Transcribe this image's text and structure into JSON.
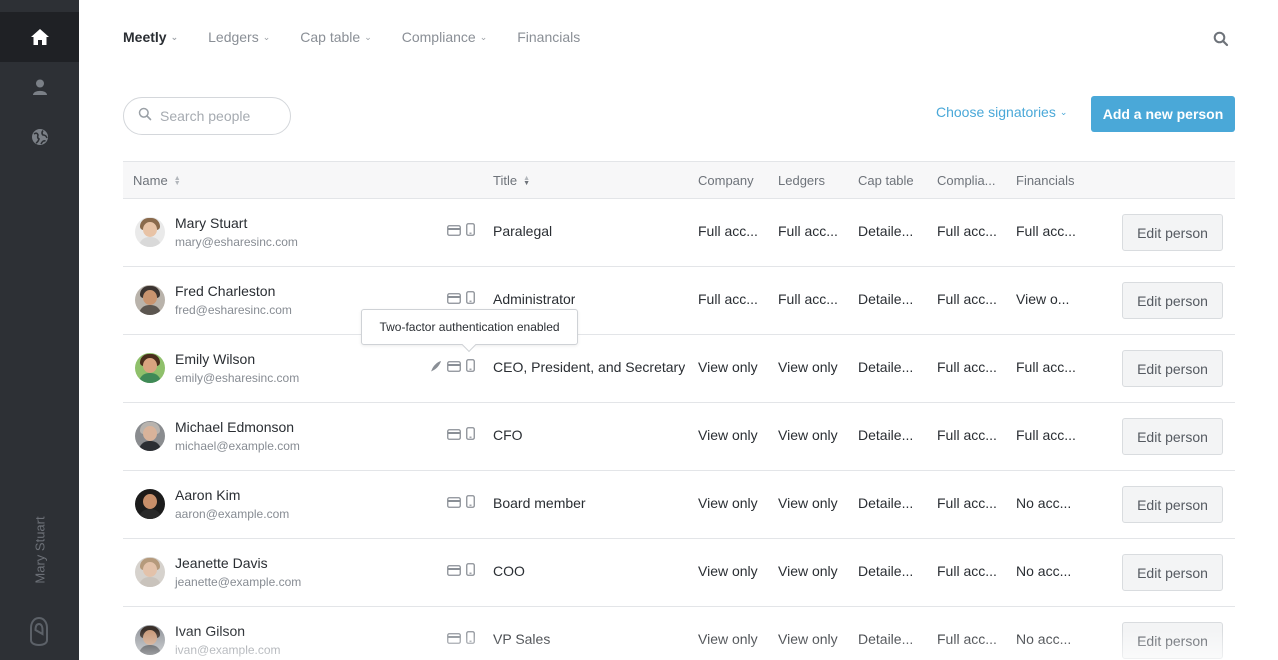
{
  "sidebar": {
    "items": [
      {
        "icon": "home-icon",
        "active": true
      },
      {
        "icon": "user-icon",
        "active": false
      },
      {
        "icon": "globe-icon",
        "active": false
      }
    ],
    "current_user": "Mary Stuart",
    "logo_icon": "eshares-logo-icon"
  },
  "topnav": {
    "items": [
      {
        "label": "Meetly",
        "dropdown": true,
        "active": true
      },
      {
        "label": "Ledgers",
        "dropdown": true,
        "active": false
      },
      {
        "label": "Cap table",
        "dropdown": true,
        "active": false
      },
      {
        "label": "Compliance",
        "dropdown": true,
        "active": false
      },
      {
        "label": "Financials",
        "dropdown": false,
        "active": false
      }
    ],
    "search_icon": "search-icon"
  },
  "toolbar": {
    "search_placeholder": "Search people",
    "choose_signatories": "Choose signatories",
    "add_person": "Add a new person"
  },
  "colors": {
    "accent": "#4aa8d8",
    "sidebar_bg": "#2d3035",
    "sidebar_active": "#1f2125"
  },
  "table": {
    "headers": {
      "name": "Name",
      "title": "Title",
      "company": "Company",
      "ledgers": "Ledgers",
      "cap_table": "Cap table",
      "compliance": "Complia...",
      "financials": "Financials"
    },
    "edit_label": "Edit person",
    "rows": [
      {
        "name": "Mary Stuart",
        "email": "mary@esharesinc.com",
        "signer": false,
        "title": "Paralegal",
        "company": "Full acc...",
        "ledgers": "Full acc...",
        "cap_table": "Detaile...",
        "compliance": "Full acc...",
        "financials": "Full acc...",
        "skin": "#e8c3a6",
        "hair": "#8a6a4c",
        "shirt": "#d9d9d9",
        "bg": "#eaeaea"
      },
      {
        "name": "Fred Charleston",
        "email": "fred@esharesinc.com",
        "signer": false,
        "title": "Administrator",
        "company": "Full acc...",
        "ledgers": "Full acc...",
        "cap_table": "Detaile...",
        "compliance": "Full acc...",
        "financials": "View o...",
        "skin": "#c9946f",
        "hair": "#3b3430",
        "shirt": "#5c5650",
        "bg": "#b9b3ab"
      },
      {
        "name": "Emily Wilson",
        "email": "emily@esharesinc.com",
        "signer": true,
        "title": "CEO, President, and Secretary",
        "company": "View only",
        "ledgers": "View only",
        "cap_table": "Detaile...",
        "compliance": "Full acc...",
        "financials": "Full acc...",
        "skin": "#d9a47f",
        "hair": "#4a2e1c",
        "shirt": "#3f8a57",
        "bg": "#8fc06b"
      },
      {
        "name": "Michael Edmonson",
        "email": "michael@example.com",
        "signer": false,
        "title": "CFO",
        "company": "View only",
        "ledgers": "View only",
        "cap_table": "Detaile...",
        "compliance": "Full acc...",
        "financials": "Full acc...",
        "skin": "#d9b39a",
        "hair": "#b8b3ae",
        "shirt": "#2b2e33",
        "bg": "#8a8c8f"
      },
      {
        "name": "Aaron Kim",
        "email": "aaron@example.com",
        "signer": false,
        "title": "Board member",
        "company": "View only",
        "ledgers": "View only",
        "cap_table": "Detaile...",
        "compliance": "Full acc...",
        "financials": "No acc...",
        "skin": "#c88f6a",
        "hair": "#1e1a18",
        "shirt": "#2a2a2a",
        "bg": "#1c1c1c"
      },
      {
        "name": "Jeanette Davis",
        "email": "jeanette@example.com",
        "signer": false,
        "title": "COO",
        "company": "View only",
        "ledgers": "View only",
        "cap_table": "Detaile...",
        "compliance": "Full acc...",
        "financials": "No acc...",
        "skin": "#e3c2aa",
        "hair": "#b59a7c",
        "shirt": "#c9c3bc",
        "bg": "#d6d2cd"
      },
      {
        "name": "Ivan Gilson",
        "email": "ivan@example.com",
        "signer": false,
        "title": "VP Sales",
        "company": "View only",
        "ledgers": "View only",
        "cap_table": "Detaile...",
        "compliance": "Full acc...",
        "financials": "No acc...",
        "skin": "#c99a7a",
        "hair": "#3a302a",
        "shirt": "#3a3d42",
        "bg": "#9a9ea3"
      }
    ]
  },
  "tooltip": {
    "text": "Two-factor authentication enabled"
  }
}
